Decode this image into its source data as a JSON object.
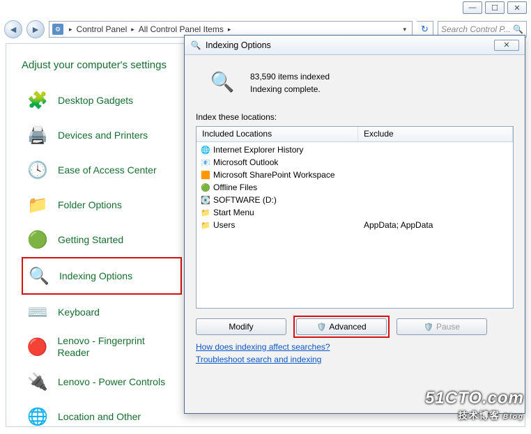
{
  "window_controls": {
    "min": "—",
    "max": "☐",
    "close": "✕"
  },
  "nav": {
    "seg1": "Control Panel",
    "seg2": "All Control Panel Items",
    "search_placeholder": "Search Control P..."
  },
  "heading": "Adjust your computer's settings",
  "cp_items": [
    {
      "icon": "🧩",
      "label": "Desktop Gadgets"
    },
    {
      "icon": "🖨️",
      "label": "Devices and Printers"
    },
    {
      "icon": "🕓",
      "label": "Ease of Access Center"
    },
    {
      "icon": "📁",
      "label": "Folder Options"
    },
    {
      "icon": "🟢",
      "label": "Getting Started"
    },
    {
      "icon": "🔍",
      "label": "Indexing Options"
    },
    {
      "icon": "⌨️",
      "label": "Keyboard"
    },
    {
      "icon": "🔴",
      "label": "Lenovo - Fingerprint Reader"
    },
    {
      "icon": "🔌",
      "label": "Lenovo - Power Controls"
    },
    {
      "icon": "🌐",
      "label": "Location and Other"
    }
  ],
  "dialog": {
    "title": "Indexing Options",
    "items_indexed": "83,590 items indexed",
    "status": "Indexing complete.",
    "locations_label": "Index these locations:",
    "col_included": "Included Locations",
    "col_exclude": "Exclude",
    "rows": [
      {
        "icon": "🌐",
        "name": "Internet Explorer History",
        "exclude": ""
      },
      {
        "icon": "📧",
        "name": "Microsoft Outlook",
        "exclude": ""
      },
      {
        "icon": "🟧",
        "name": "Microsoft SharePoint Workspace",
        "exclude": ""
      },
      {
        "icon": "🟢",
        "name": "Offline Files",
        "exclude": ""
      },
      {
        "icon": "💽",
        "name": "SOFTWARE (D:)",
        "exclude": ""
      },
      {
        "icon": "📁",
        "name": "Start Menu",
        "exclude": ""
      },
      {
        "icon": "📁",
        "name": "Users",
        "exclude": "AppData; AppData"
      }
    ],
    "modify": "Modify",
    "advanced": "Advanced",
    "pause": "Pause",
    "link1": "How does indexing affect searches?",
    "link2": "Troubleshoot search and indexing"
  },
  "watermark": {
    "line1": "51CTO.com",
    "line2": "技术博客",
    "blog": "Blog"
  }
}
